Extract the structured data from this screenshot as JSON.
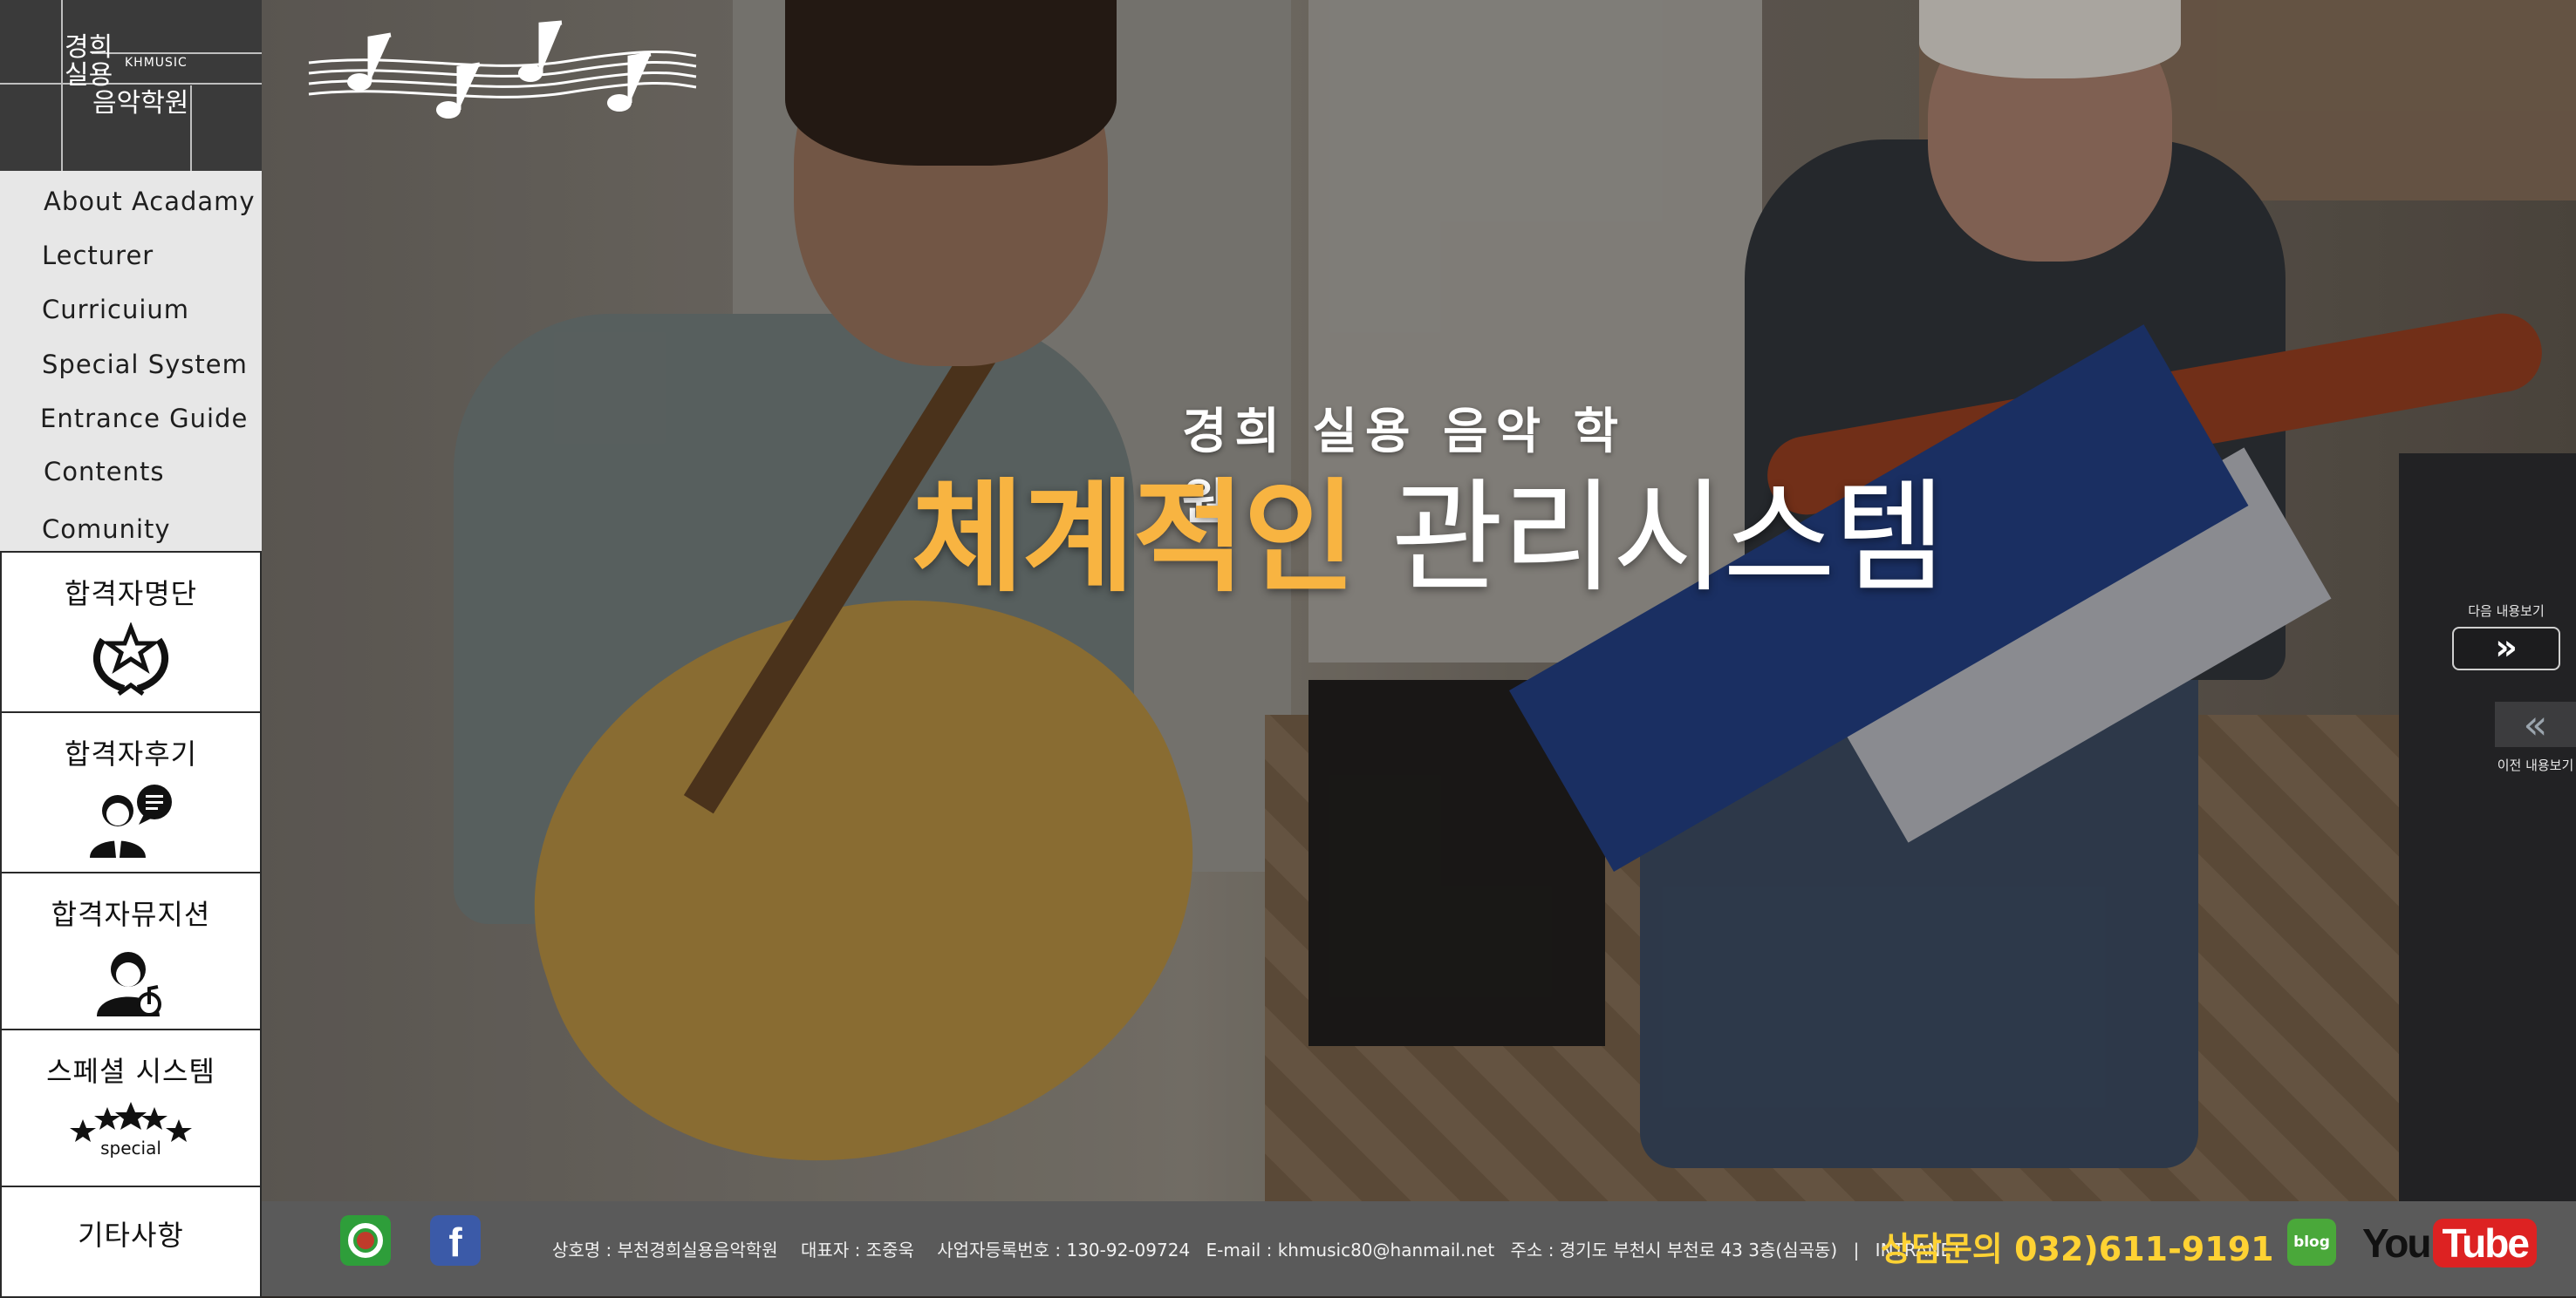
{
  "brand": {
    "line1": "경희",
    "line2": "실용",
    "line3": "음악학원",
    "english": "KHMUSIC"
  },
  "nav": {
    "items": [
      {
        "label": "About Acadamy"
      },
      {
        "label": "Lecturer"
      },
      {
        "label": "Curricuium"
      },
      {
        "label": "Special System"
      },
      {
        "label": "Entrance Guide"
      },
      {
        "label": "Contents"
      },
      {
        "label": "Comunity"
      }
    ]
  },
  "quick_links": [
    {
      "label": "합격자명단",
      "icon": "laurel-star-icon"
    },
    {
      "label": "합격자후기",
      "icon": "people-chat-icon"
    },
    {
      "label": "합격자뮤지션",
      "icon": "musician-icon"
    },
    {
      "label": "스페셜 시스템",
      "icon": "special-stars-icon",
      "badge": "special"
    },
    {
      "label": "기타사항"
    }
  ],
  "hero": {
    "kicker": "경희 실용 음악 학원",
    "headline_accent": "체계적인",
    "headline_main": "관리시스템"
  },
  "slider": {
    "next_label": "다음 내용보기",
    "next_glyph": "»",
    "prev_label": "이전 내용보기",
    "prev_glyph": "«"
  },
  "footer": {
    "facebook_glyph": "f",
    "company": "상호명 : 부천경희실용음악학원",
    "ceo": "대표자 : 조중욱",
    "biz_no": "사업자등록번호 : 130-92-09724",
    "email": "E-mail : khmusic80@hanmail.net",
    "address": "주소 : 경기도 부천시 부천로 43 3층(심곡동)",
    "separator": "|",
    "intranet": "INTRANET",
    "consult": "상담문의 032)611-9191",
    "blog": "blog",
    "youtube_you": "You",
    "youtube_tube": "Tube"
  },
  "colors": {
    "accent": "#f8b441",
    "consult": "#ffd233",
    "menu_bg": "#e7e7e7",
    "logo_bg": "#3a3a3a",
    "footer_bg": "#5a5a5a"
  }
}
